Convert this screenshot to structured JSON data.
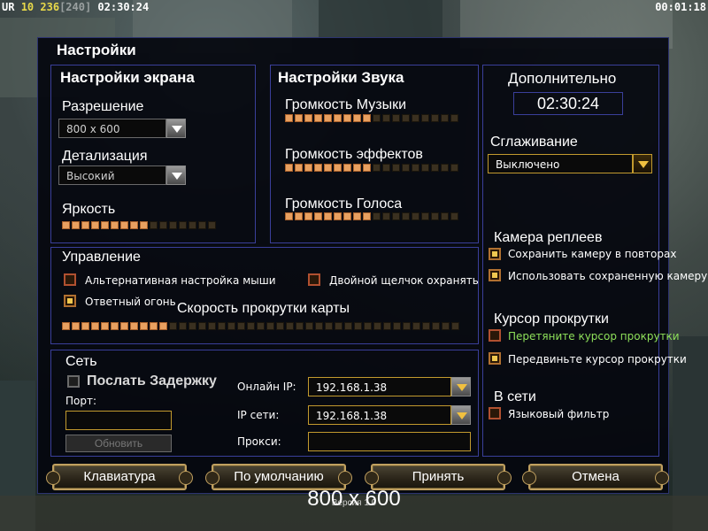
{
  "hud": {
    "left_tag": "UR",
    "left_a": "10",
    "left_b": "236",
    "left_c": "[240]",
    "left_time": "02:30:24",
    "right_time": "00:01:18"
  },
  "dialog": {
    "title": "Настройки",
    "screen": {
      "title": "Настройки экрана",
      "resolution_label": "Разрешение",
      "resolution_value": "800 x 600",
      "detail_label": "Детализация",
      "detail_value": "Высокий",
      "brightness_label": "Яркость",
      "brightness_level": 0.56
    },
    "sound": {
      "title": "Настройки Звука",
      "music_label": "Громкость Музыки",
      "music_level": 0.5,
      "effects_label": "Громкость эффектов",
      "effects_level": 0.5,
      "voice_label": "Громкость Голоса",
      "voice_level": 0.5
    },
    "extra": {
      "title": "Дополнительно",
      "clock": "02:30:24",
      "antialias_label": "Сглаживание",
      "antialias_value": "Выключено",
      "replay_camera_title": "Камера реплеев",
      "replay_save_camera": "Сохранить камеру в повторах",
      "replay_use_saved_camera": "Использовать сохраненную камеру",
      "scroll_cursor_title": "Курсор прокрутки",
      "scroll_drag": "Перетяните курсор прокрутки",
      "scroll_move": "Передвиньте курсор прокрутки",
      "online_title": "В сети",
      "language_filter": "Языковый фильтр"
    },
    "control": {
      "title": "Управление",
      "alt_mouse": "Альтернативная настройка мыши",
      "double_click_guard": "Двойной щелчок охранять",
      "return_fire": "Ответный огонь",
      "scroll_speed_label": "Скорость прокрутки карты",
      "scroll_speed_level": 0.28
    },
    "network": {
      "title": "Сеть",
      "send_delay": "Послать Задержку",
      "port_label": "Порт:",
      "port_value": "",
      "refresh_button": "Обновить",
      "online_ip_label": "Онлайн IP:",
      "online_ip_value": "192.168.1.38",
      "lan_ip_label": "IP сети:",
      "lan_ip_value": "192.168.1.38",
      "proxy_label": "Прокси:",
      "proxy_value": ""
    },
    "buttons": {
      "keyboard": "Клавиатура",
      "defaults": "По умолчанию",
      "accept": "Принять",
      "cancel": "Отмена"
    }
  },
  "footer": {
    "resolution": "800 x 600",
    "version": "Версия 1.0"
  },
  "colors": {
    "panel_border": "#3a3f9a",
    "accent_gold": "#c29a2e",
    "slider_on": "#e8a060",
    "highlight_green": "#8ee05a"
  }
}
